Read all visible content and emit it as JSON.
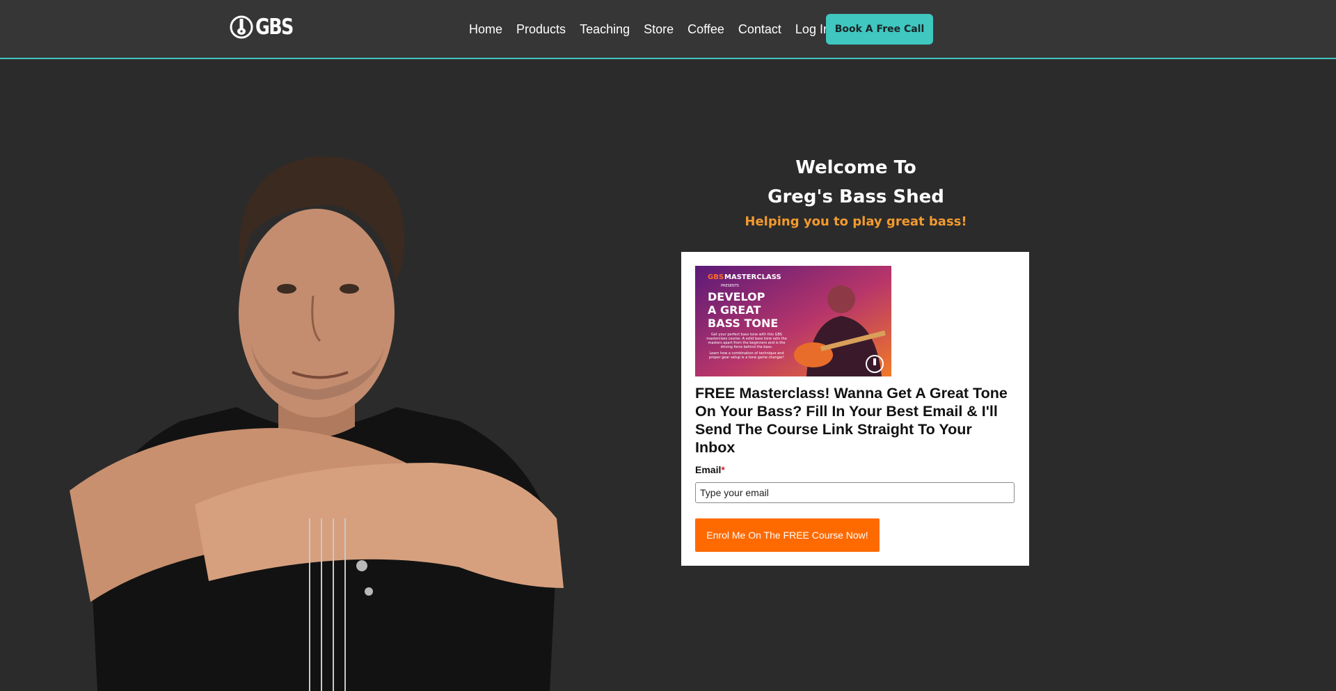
{
  "header": {
    "logo_text": "GBS",
    "nav": [
      "Home",
      "Products",
      "Teaching",
      "Store",
      "Coffee",
      "Contact",
      "Log In"
    ],
    "cta_label": "Book A Free Call"
  },
  "hero": {
    "title_line1": "Welcome To",
    "title_line2": "Greg's Bass Shed",
    "subtitle": "Helping you to play great bass!"
  },
  "promo": {
    "brand_left": "GBS",
    "brand_right": "MASTERCLASS",
    "presents": "PRESENTS",
    "headline": [
      "DEVELOP",
      "A GREAT",
      "BASS TONE"
    ],
    "blurb": "Get your perfect bass tone with this GBS masterclass course. A solid bass tone sets the masters apart from the beginners and is the driving force behind the bass.",
    "blurb2": "Learn how a combination of technique and proper gear setup is a tone game changer!"
  },
  "form": {
    "heading": "FREE Masterclass! Wanna Get A Great Tone On Your Bass? Fill In Your Best Email & I'll Send The Course Link Straight To Your Inbox",
    "email_label": "Email",
    "required_mark": "*",
    "email_placeholder": "Type your email",
    "submit_label": "Enrol Me On The FREE Course Now!"
  },
  "colors": {
    "background": "#2b2b2b",
    "header": "#363636",
    "accent_teal": "#3fc7c0",
    "accent_orange_text": "#f29a2e",
    "button_orange": "#ff6a00"
  },
  "icons": [
    "gbs-logo-icon"
  ]
}
